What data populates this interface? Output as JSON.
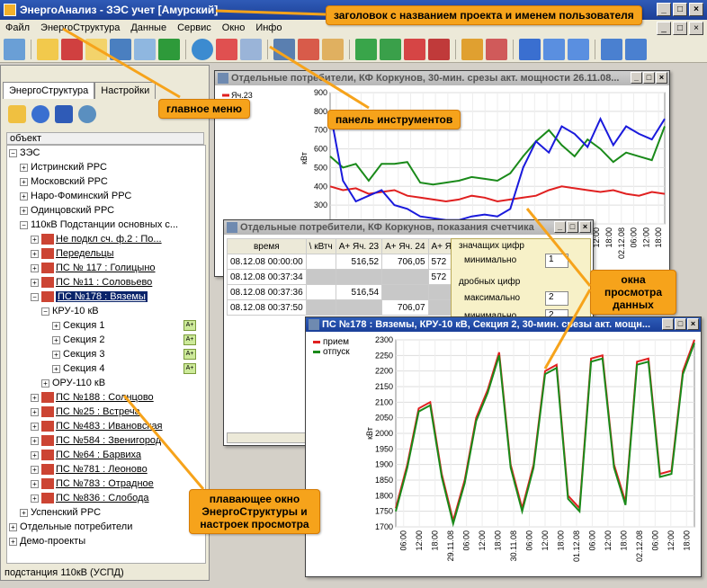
{
  "app": {
    "title": "ЭнергоАнализ - ЗЭС учет [Амурский]"
  },
  "menu": [
    "Файл",
    "ЭнергоСтруктура",
    "Данные",
    "Сервис",
    "Окно",
    "Инфо"
  ],
  "left_panel": {
    "tabs": [
      "ЭнергоСтруктура",
      "Настройки"
    ],
    "column_header": "объект",
    "tree": [
      {
        "label": "ЗЭС"
      },
      {
        "label": "Истринский РРС"
      },
      {
        "label": "Московский РРС"
      },
      {
        "label": "Наро-Фоминский РРС"
      },
      {
        "label": "Одинцовский РРС"
      },
      {
        "label": "110кВ  Подстанции основных с..."
      },
      {
        "label": "Не подкл сч. ф.2 : По..."
      },
      {
        "label": "Передельцы"
      },
      {
        "label": "ПС № 117 : Голицыно"
      },
      {
        "label": "ПС №11 : Соловьево"
      },
      {
        "label": "ПС №178 : Вяземы"
      },
      {
        "label": "КРУ-10 кВ"
      },
      {
        "label": "Секция 1"
      },
      {
        "label": "Секция 2"
      },
      {
        "label": "Секция 3"
      },
      {
        "label": "Секция 4"
      },
      {
        "label": "ОРУ-110 кВ"
      },
      {
        "label": "ПС №188 : Солнцово"
      },
      {
        "label": "ПС №25 : Встреча"
      },
      {
        "label": "ПС №483 : Ивановская"
      },
      {
        "label": "ПС №584 : Звенигород"
      },
      {
        "label": "ПС №64 : Барвиха"
      },
      {
        "label": "ПС №781 : Леоново"
      },
      {
        "label": "ПС №783 : Отрадное"
      },
      {
        "label": "ПС №836 : Слобода"
      },
      {
        "label": "Успенский РРС"
      },
      {
        "label": "Отдельные потребители"
      },
      {
        "label": "Демо-проекты"
      }
    ],
    "status": "подстанция 110кВ (УСПД)"
  },
  "windows": {
    "chart1": {
      "title": "Отдельные потребители, КФ Коркунов, 30-мин. срезы акт. мощности 26.11.08...",
      "legend": "Яч.23",
      "ylabel": "кВт"
    },
    "table": {
      "title": "Отдельные потребители, КФ Коркунов, показания счетчика",
      "headers": [
        "время",
        "\\ кВтч",
        "А+ Яч. 23",
        "А+ Яч. 24",
        "А+ Яч."
      ],
      "rows": [
        [
          "08.12.08 00:00:00",
          "",
          "516,52",
          "706,05",
          "572"
        ],
        [
          "08.12.08 00:37:34",
          "",
          "",
          "",
          "572"
        ],
        [
          "08.12.08 00:37:36",
          "",
          "516,54",
          "",
          ""
        ],
        [
          "08.12.08 00:37:50",
          "",
          "",
          "706,07",
          ""
        ]
      ],
      "settings": {
        "group1": "значащих цифр",
        "min_label": "минимально",
        "min_value": "1",
        "group2": "дробных цифр",
        "max_label": "максимально",
        "max_value": "2",
        "min2_label": "минимально",
        "min2_value": "2"
      }
    },
    "chart2": {
      "title": "ПС №178 : Вяземы, КРУ-10 кВ, Секция 2, 30-мин. срезы акт. мощн...",
      "legend": [
        "прием",
        "отпуск"
      ],
      "ylabel": "кВт"
    }
  },
  "callouts": {
    "title": "заголовок с названием проекта и именем пользователя",
    "menu": "главное меню",
    "toolbar": "панель инструментов",
    "views": "окна просмотра данных",
    "float": "плавающее окно ЭнергоСтруктуры и настроек просмотра"
  },
  "chart_data": [
    {
      "type": "line",
      "ylabel": "кВт",
      "ylim": [
        200,
        900
      ],
      "yticks": [
        200,
        300,
        400,
        500,
        600,
        700,
        800,
        900
      ],
      "xticks": [
        "06:00",
        "12:00",
        "18:00",
        "27.11.08",
        "06:00",
        "12:00",
        "18:00",
        "28.11.08",
        "06:00",
        "12:00",
        "18:00",
        "29.11.08",
        "06:00",
        "12:00",
        "18:00",
        "30.11.08",
        "06:00",
        "12:00",
        "18:00",
        "01.12.08",
        "06:00",
        "12:00",
        "18:00",
        "02.12.08",
        "06:00",
        "12:00",
        "18:00"
      ],
      "series": [
        {
          "name": "Яч.23",
          "color": "#e02020",
          "values": [
            400,
            380,
            390,
            360,
            370,
            380,
            350,
            340,
            330,
            320,
            330,
            350,
            340,
            320,
            330,
            340,
            350,
            380,
            400,
            390,
            380,
            370,
            380,
            360,
            350,
            370,
            360
          ]
        },
        {
          "name": "",
          "color": "#1a8a1a",
          "values": [
            560,
            500,
            520,
            430,
            520,
            520,
            530,
            420,
            410,
            420,
            430,
            450,
            440,
            430,
            470,
            560,
            640,
            700,
            620,
            560,
            650,
            600,
            530,
            580,
            560,
            540,
            720
          ]
        },
        {
          "name": "",
          "color": "#1a1adc",
          "values": [
            800,
            430,
            320,
            350,
            380,
            300,
            280,
            240,
            230,
            220,
            220,
            240,
            250,
            240,
            280,
            500,
            640,
            580,
            720,
            680,
            610,
            760,
            620,
            720,
            680,
            650,
            760
          ]
        }
      ]
    },
    {
      "type": "line",
      "ylabel": "кВт",
      "ylim": [
        1700,
        2300
      ],
      "yticks": [
        1700,
        1750,
        1800,
        1850,
        1900,
        1950,
        2000,
        2050,
        2100,
        2150,
        2200,
        2250,
        2300
      ],
      "xticks": [
        "06:00",
        "12:00",
        "18:00",
        "29.11.08",
        "06:00",
        "12:00",
        "18:00",
        "30.11.08",
        "06:00",
        "12:00",
        "18:00",
        "01.12.08",
        "06:00",
        "12:00",
        "18:00",
        "02.12.08",
        "06:00",
        "12:00",
        "18:00"
      ],
      "series": [
        {
          "name": "прием",
          "color": "#e02020",
          "values": [
            1760,
            1900,
            2080,
            2100,
            1870,
            1720,
            1850,
            2050,
            2140,
            2260,
            1900,
            1760,
            1900,
            2200,
            2220,
            1800,
            1760,
            2240,
            2250,
            1900,
            1780,
            2230,
            2240,
            1870,
            1880,
            2200,
            2300
          ]
        },
        {
          "name": "отпуск",
          "color": "#1a8a1a",
          "values": [
            1750,
            1890,
            2070,
            2090,
            1860,
            1710,
            1840,
            2040,
            2130,
            2250,
            1890,
            1750,
            1890,
            2190,
            2210,
            1790,
            1750,
            2230,
            2240,
            1890,
            1770,
            2220,
            2230,
            1860,
            1870,
            2190,
            2290
          ]
        }
      ]
    }
  ]
}
